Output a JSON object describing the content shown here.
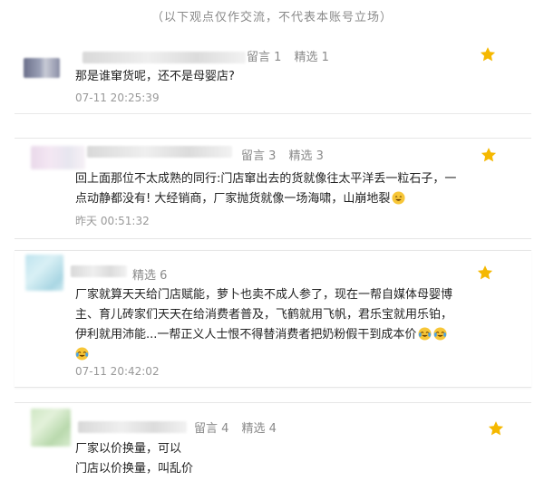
{
  "disclaimer": "（以下观点仅作交流，不代表本账号立场）",
  "comments": [
    {
      "messages_label": "留言 1",
      "featured_label": "精选 1",
      "lines": [
        "那是谁窜货呢，还不是母婴店?"
      ],
      "time": "07-11 20:25:39"
    },
    {
      "messages_label": "留言 3",
      "featured_label": "精选 3",
      "lines": [
        "回上面那位不太成熟的同行:门店窜出去的货就像往太平洋丢一粒石子，一",
        "点动静都没有! 大经销商，厂家抛货就像一场海啸，山崩地裂"
      ],
      "time": "昨天 00:51:32"
    },
    {
      "messages_label": "",
      "featured_label": "精选 6",
      "lines": [
        "厂家就算天天给门店赋能，萝卜也卖不成人参了，现在一帮自媒体母婴博",
        "主、育儿砖家们天天在给消费者普及，飞鹤就用飞帆，君乐宝就用乐铂，",
        "伊利就用沛能...一帮正义人士恨不得替消费者把奶粉假干到成本价"
      ],
      "time": "07-11 20:42:02"
    },
    {
      "messages_label": "留言 4",
      "featured_label": "精选 4",
      "lines": [
        "厂家以价换量，可以",
        "门店以价换量，叫乱价"
      ],
      "time": ""
    }
  ],
  "colors": {
    "star": "#f5b800",
    "meta": "#8a8a8a",
    "text": "#222222"
  },
  "icons": [
    "star-icon",
    "laughing-emoji-icon",
    "crying-laughing-emoji-icon"
  ]
}
